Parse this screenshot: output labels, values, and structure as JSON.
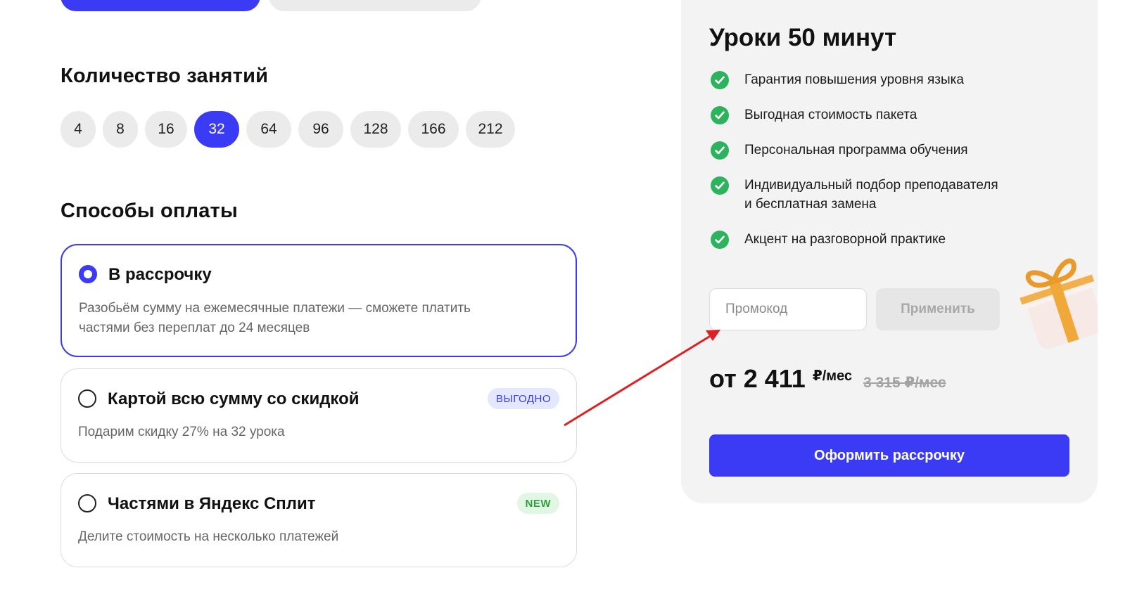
{
  "count_section": {
    "title": "Количество занятий",
    "options": [
      {
        "label": "4",
        "selected": false
      },
      {
        "label": "8",
        "selected": false
      },
      {
        "label": "16",
        "selected": false
      },
      {
        "label": "32",
        "selected": true
      },
      {
        "label": "64",
        "selected": false
      },
      {
        "label": "96",
        "selected": false
      },
      {
        "label": "128",
        "selected": false
      },
      {
        "label": "166",
        "selected": false
      },
      {
        "label": "212",
        "selected": false
      }
    ]
  },
  "payment_section": {
    "title": "Способы оплаты",
    "methods": [
      {
        "title": "В рассрочку",
        "description_line1": "Разобьём сумму на ежемесячные платежи — сможете платить",
        "description_line2": "частями без переплат до 24 месяцев",
        "selected": true
      },
      {
        "title": "Картой всю сумму со скидкой",
        "description": "Подарим скидку 27% на 32 урока",
        "badge": "ВЫГОДНО",
        "selected": false
      },
      {
        "title": "Частями в Яндекс Сплит",
        "description": "Делите стоимость на несколько платежей",
        "badge": "NEW",
        "selected": false
      }
    ]
  },
  "summary": {
    "title": "Уроки 50 минут",
    "benefits": [
      "Гарантия повышения уровня языка",
      "Выгодная стоимость пакета",
      "Персональная программа обучения",
      "Индивидуальный подбор преподавателя",
      "и бесплатная замена",
      "Акцент на разговорной практике"
    ],
    "promo_placeholder": "Промокод",
    "apply_label": "Применить",
    "price": "от 2 411",
    "price_unit": "₽/мес",
    "old_price": "3 315 ₽/мес",
    "cta_label": "Оформить рассрочку"
  },
  "colors": {
    "accent": "#3b3bf5",
    "check_green": "#2db35d",
    "annotation_arrow": "#e02020"
  },
  "icons": [
    "radio-selected",
    "radio-empty",
    "check-circle-icon",
    "gift-icon",
    "annotation-arrow"
  ]
}
